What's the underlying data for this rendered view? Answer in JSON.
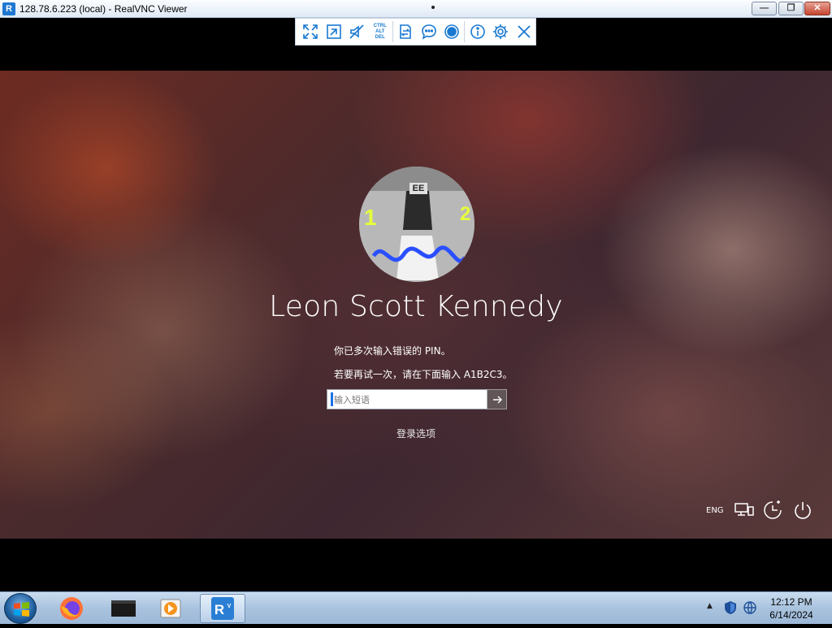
{
  "window": {
    "title": "128.78.6.223 (local) - RealVNC Viewer",
    "app_icon": "realvnc-icon",
    "controls": {
      "minimize": "—",
      "maximize": "❐",
      "close": "✕"
    }
  },
  "vnc_toolbar": {
    "buttons": [
      {
        "name": "fullscreen-icon"
      },
      {
        "name": "scale-icon"
      },
      {
        "name": "mute-audio-icon"
      },
      {
        "name": "ctrl-alt-del-icon",
        "lines": [
          "CTRL",
          "ALT",
          "DEL"
        ]
      },
      {
        "name": "file-transfer-icon"
      },
      {
        "name": "chat-icon"
      },
      {
        "name": "record-icon"
      },
      {
        "name": "info-icon"
      },
      {
        "name": "settings-icon"
      },
      {
        "name": "disconnect-icon"
      }
    ],
    "accent_color": "#1979d2"
  },
  "lock_screen": {
    "user_name": "Leon Scott Kennedy",
    "avatar_marks": [
      "EE",
      "1",
      "2"
    ],
    "message_line1": "你已多次输入错误的 PIN。",
    "message_line2": "若要再试一次，请在下面输入 A1B2C3。",
    "input_placeholder": "输入短语",
    "input_value": "",
    "submit_icon": "arrow-right-icon",
    "signin_options": "登录选项",
    "language": "ENG",
    "bottom_icons": [
      "network-icon",
      "accessibility-icon",
      "power-icon"
    ]
  },
  "taskbar": {
    "apps": [
      "windows-start-icon",
      "firefox-icon",
      "terminal-icon",
      "media-player-icon",
      "realvnc-icon"
    ],
    "tray_arrow": "▲",
    "tray_icons": [
      "security-shield-icon",
      "network-globe-icon"
    ],
    "time": "12:12 PM",
    "date": "6/14/2024"
  }
}
